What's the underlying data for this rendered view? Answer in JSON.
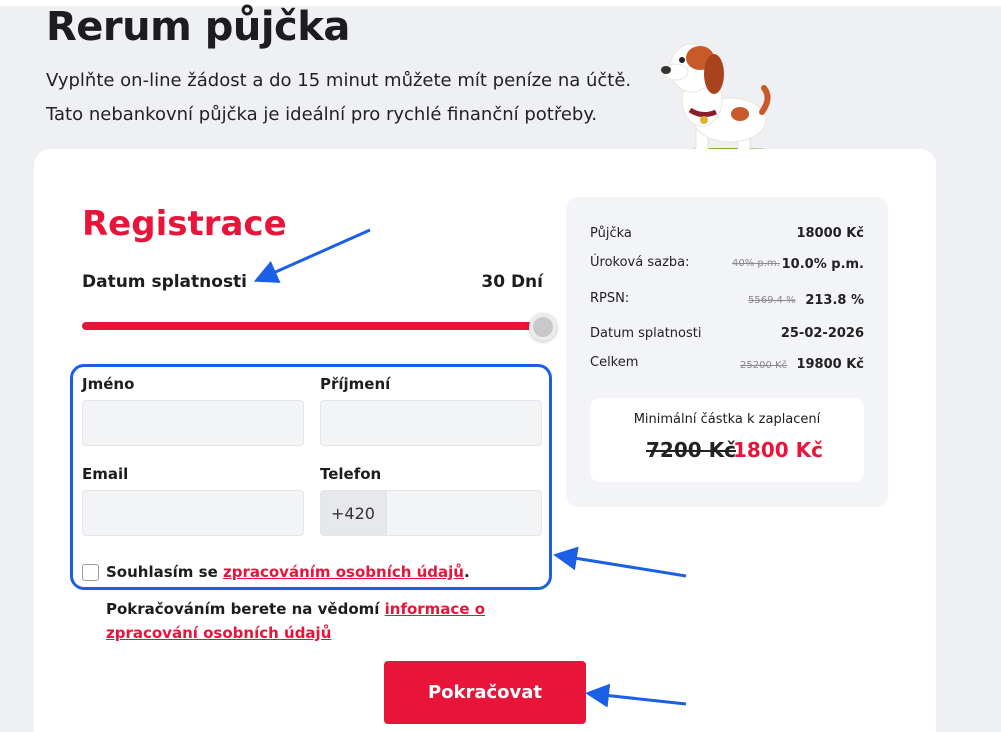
{
  "hero": {
    "title": "Rerum půjčka",
    "line1": "Vyplňte on-line žádost a do 15 minut můžete mít peníze na účtě.",
    "line2": "Tato nebankovní půjčka je ideální pro rychlé finanční potřeby."
  },
  "registration": {
    "title": "Registrace",
    "due_label": "Datum splatnosti",
    "due_value": "30 Dní",
    "slider_fraction": 1.0
  },
  "form": {
    "first_name_label": "Jméno",
    "first_name_value": "",
    "last_name_label": "Příjmení",
    "last_name_value": "",
    "email_label": "Email",
    "email_value": "",
    "phone_label": "Telefon",
    "phone_prefix": "+420",
    "phone_value": "",
    "consent_prefix": "Souhlasím se ",
    "consent_link": "zpracováním osobních údajů",
    "consent_suffix": ".",
    "consent_checked": false,
    "notice_prefix": "Pokračováním berete na vědomí ",
    "notice_link": "informace o zpracování osobních údajů"
  },
  "cta": {
    "label": "Pokračovat"
  },
  "summary": {
    "loan_label": "Půjčka",
    "loan_value": "18000 Kč",
    "rate_label": "Úroková sazba:",
    "rate_old": "40% p.m.",
    "rate_value": "10.0% p.m.",
    "rpsn_label": "RPSN:",
    "rpsn_old": "5569.4 %",
    "rpsn_value": "213.8 %",
    "due_label": "Datum splatnosti",
    "due_value": "25-02-2026",
    "total_label": "Celkem",
    "total_old": "25200 Kč",
    "total_value": "19800 Kč",
    "min_label": "Minimální částka k zaplacení",
    "min_old": "7200 Kč",
    "min_value": "1800 Kč"
  },
  "colors": {
    "accent": "#e8143a",
    "annotation": "#1b5fe6"
  }
}
